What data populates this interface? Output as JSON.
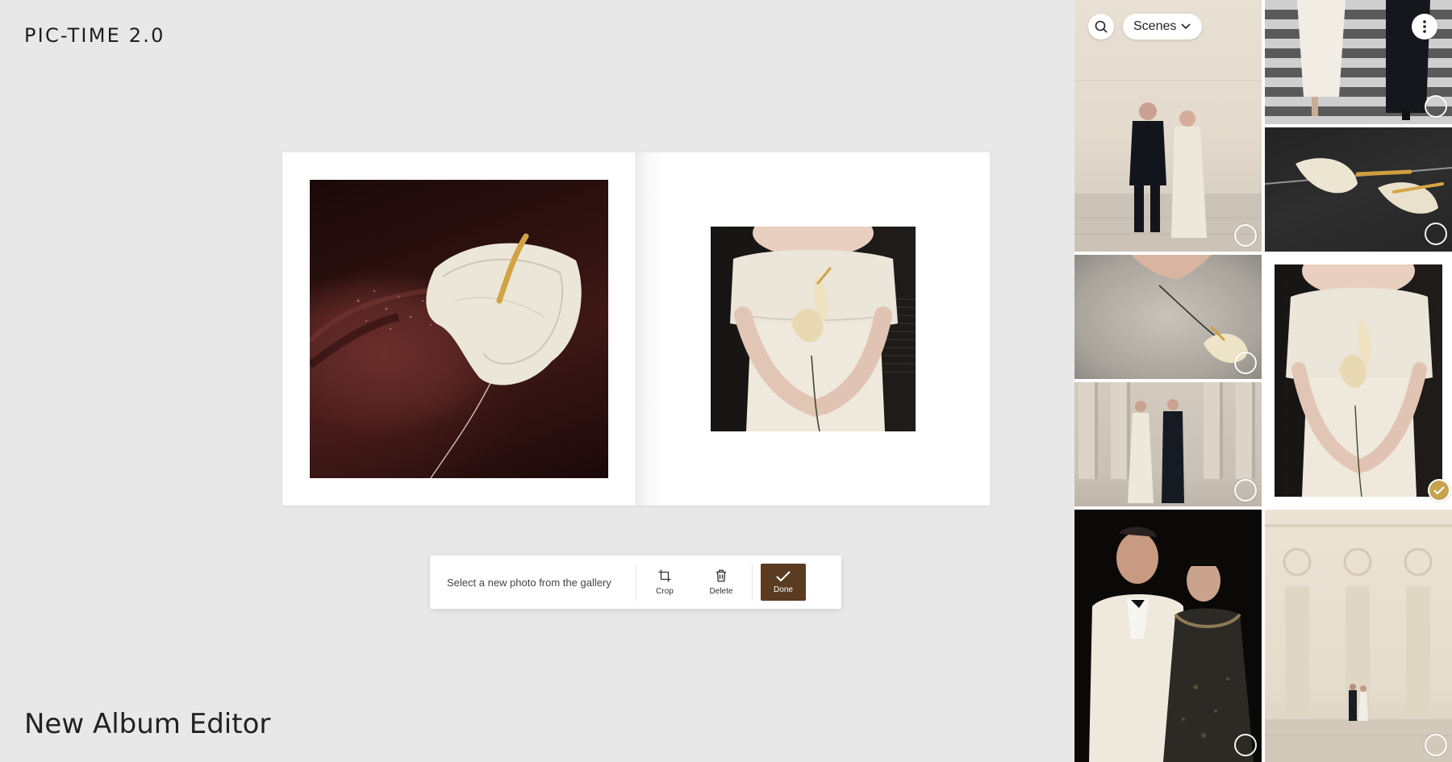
{
  "brand": "PIC-TIME 2.0",
  "page_title": "New Album Editor",
  "toolbar": {
    "hint": "Select a new photo from the gallery",
    "crop_label": "Crop",
    "delete_label": "Delete",
    "done_label": "Done"
  },
  "gallery": {
    "scenes_label": "Scenes",
    "thumbnails": [
      {
        "id": "couple-street",
        "selected": false
      },
      {
        "id": "walking-crosswalk",
        "selected": false
      },
      {
        "id": "flowers-asphalt",
        "selected": false
      },
      {
        "id": "hands-flower-tulle",
        "selected": false
      },
      {
        "id": "bride-holding-flower",
        "selected": true
      },
      {
        "id": "couple-columns",
        "selected": false
      },
      {
        "id": "couple-tuxedo-portrait",
        "selected": false
      },
      {
        "id": "couple-facade",
        "selected": false
      }
    ]
  },
  "colors": {
    "background": "#e8e8e8",
    "done_button": "#5a3c22",
    "selected_check": "#c7a24f"
  }
}
